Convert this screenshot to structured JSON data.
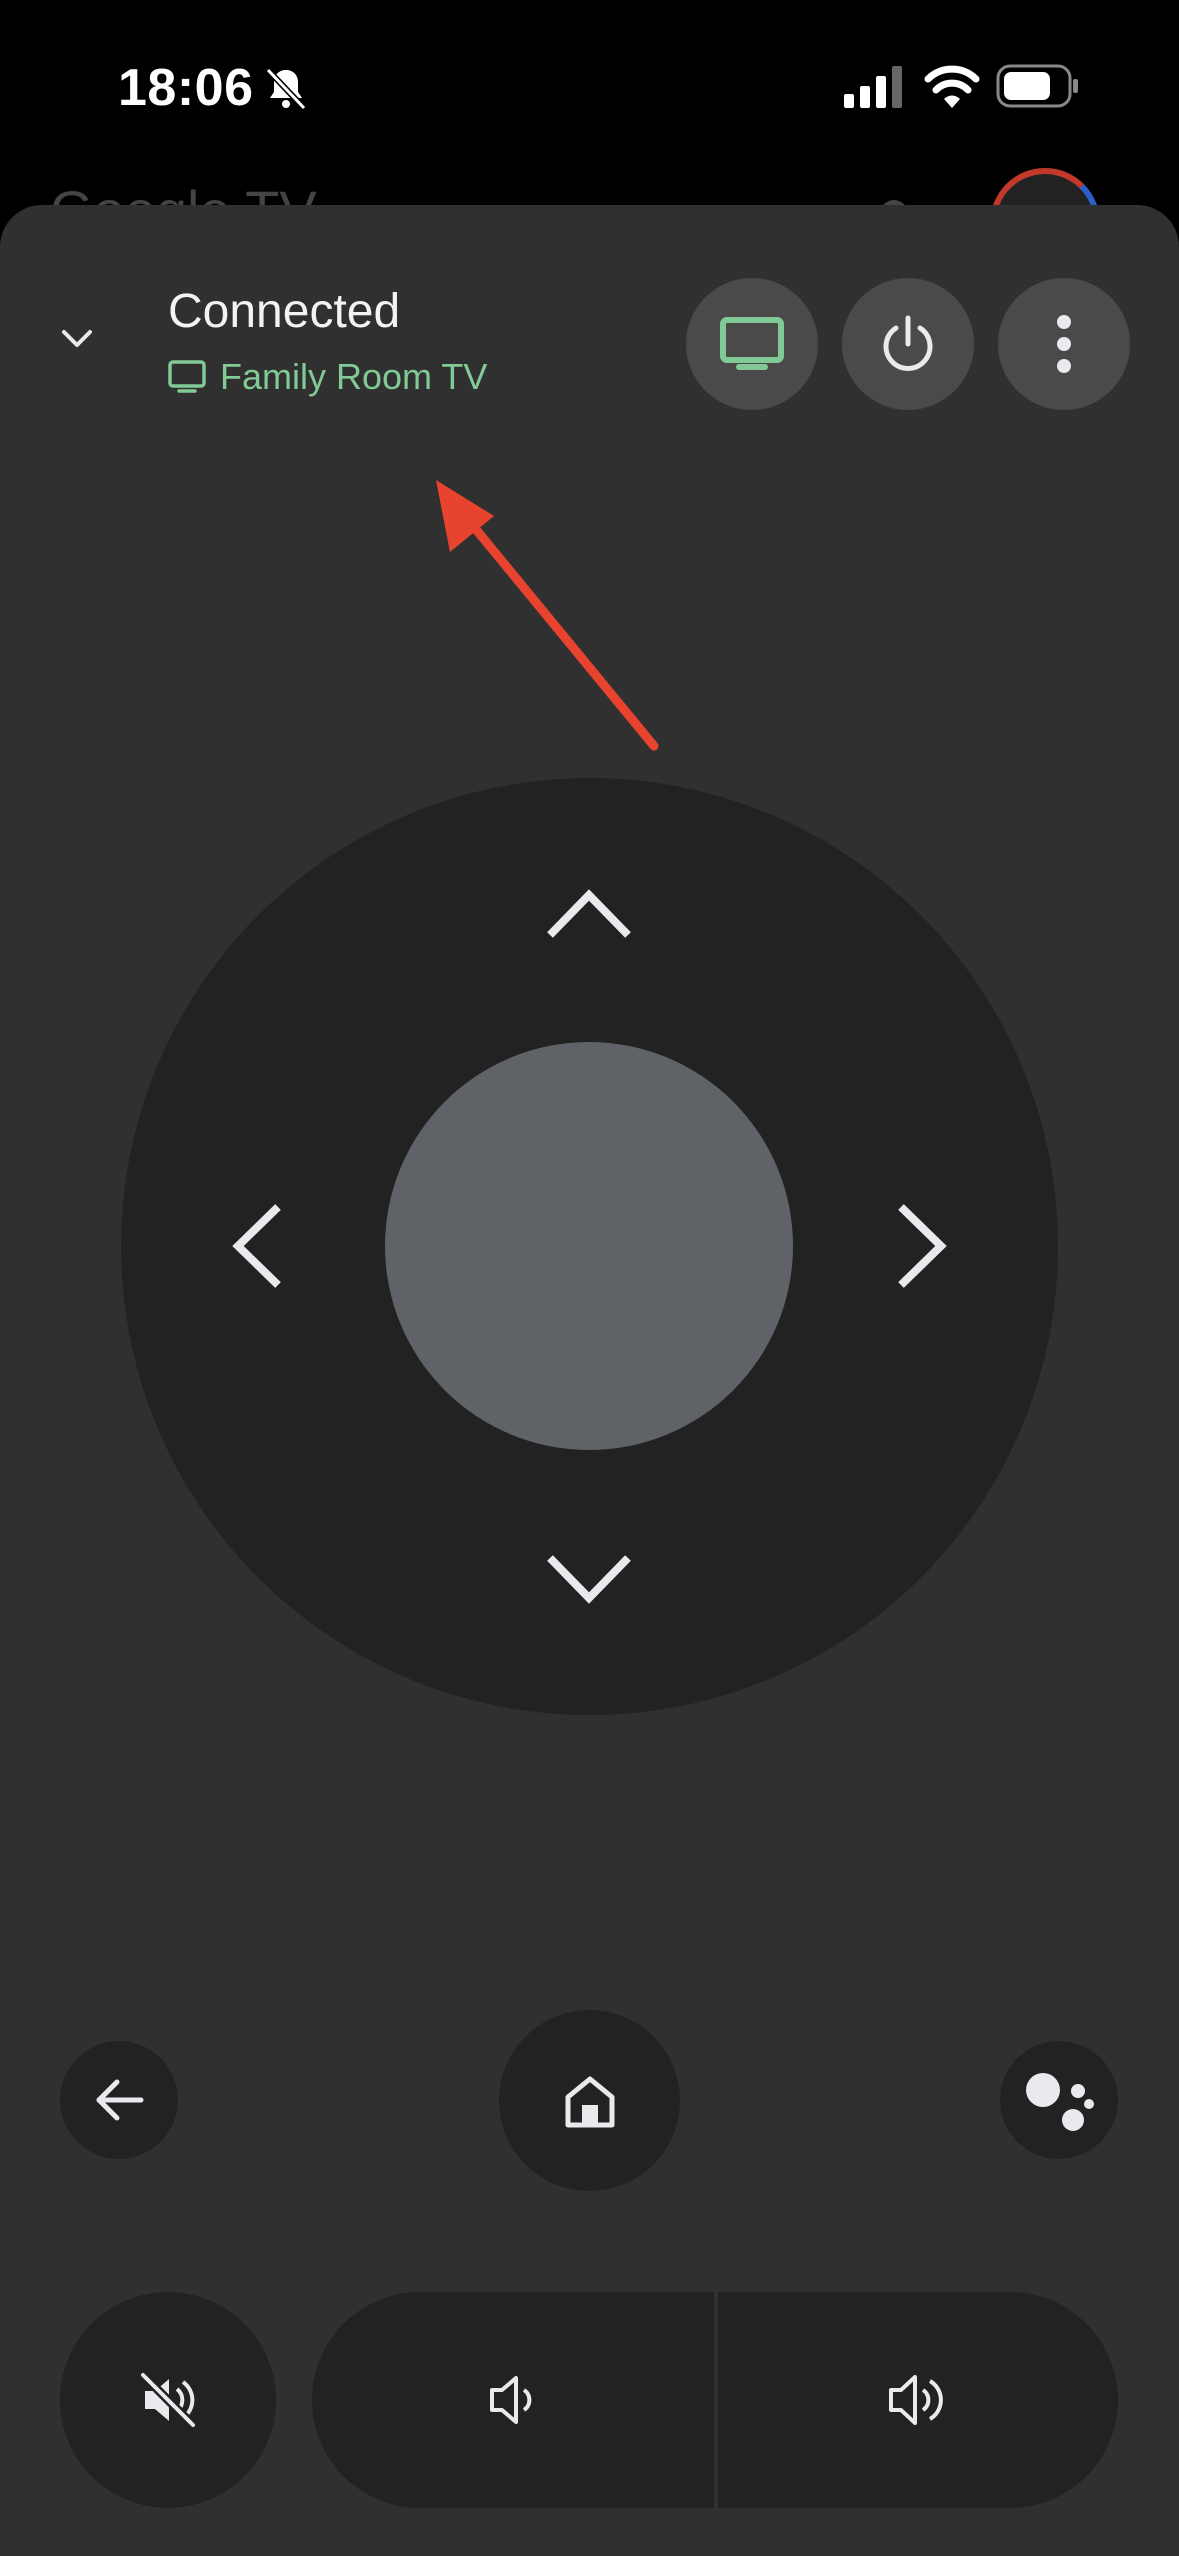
{
  "status_bar": {
    "time": "18:06",
    "icons": [
      "bell-off-icon",
      "signal-icon",
      "wifi-icon",
      "battery-icon"
    ]
  },
  "background_app": {
    "title": "Google TV"
  },
  "remote": {
    "header": {
      "title": "Connected",
      "device_name": "Family Room TV",
      "device_icon": "tv-outline-icon"
    },
    "top_buttons": [
      {
        "name": "tv-input",
        "icon": "tv-icon"
      },
      {
        "name": "power",
        "icon": "power-icon"
      },
      {
        "name": "more-options",
        "icon": "more-vertical-icon"
      }
    ],
    "dpad": {
      "directions": [
        "up",
        "down",
        "left",
        "right"
      ],
      "center": "select"
    },
    "nav_buttons": [
      "back",
      "home",
      "assistant"
    ],
    "volume_buttons": [
      "mute",
      "volume-down",
      "volume-up"
    ]
  },
  "colors": {
    "sheet_bg": "#303030",
    "button_bg": "#222222",
    "top_button_bg": "#4a4a4a",
    "dpad_center": "#5f6368",
    "connected_green": "#81c995",
    "annotation_red": "#e8432f"
  }
}
